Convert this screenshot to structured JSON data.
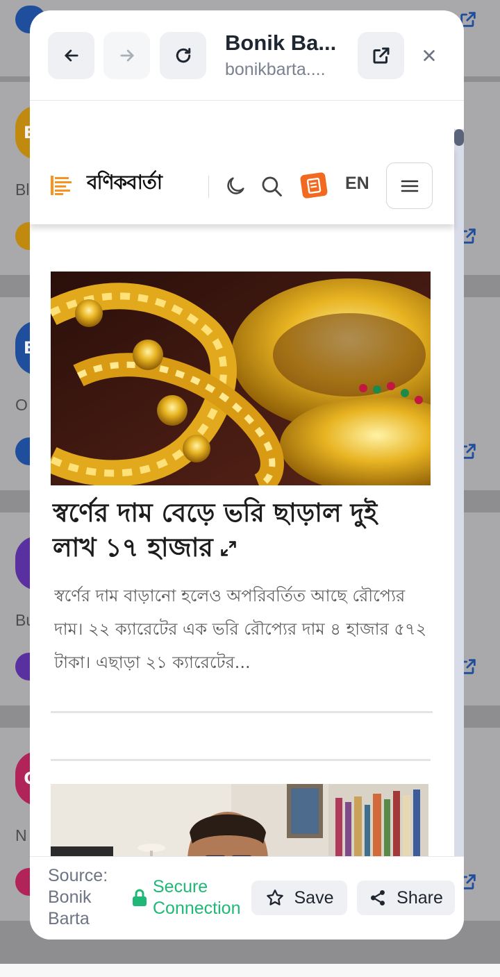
{
  "modal": {
    "title": "Bonik Ba...",
    "url": "bonikbarta....",
    "back_label": "Back",
    "forward_label": "Forward",
    "reload_label": "Reload",
    "open_external_label": "Open in browser",
    "close_label": "Close"
  },
  "site": {
    "logo_text": "বণিকবার্তা",
    "language_toggle": "EN"
  },
  "article": {
    "headline": "স্বর্ণের দাম বেড়ে ভরি ছাড়াল দুই লাখ ১৭ হাজার",
    "summary": "স্বর্ণের দাম বাড়ানো হলেও অপরিবর্তিত আছে রৌপ্যের দাম। ২২ ক্যারেটের এক ভরি রৌপ্যের দাম ৪ হাজার ৫৭২ টাকা। এছাড়া ২১ ক্যারেটের..."
  },
  "footer": {
    "source": "Source: Bonik Barta",
    "secure": "Secure Connection",
    "save_label": "Save",
    "share_label": "Share"
  },
  "background": {
    "avatars": [
      "B",
      "B",
      "C"
    ],
    "snippets": [
      "Bl",
      "O",
      "Bu",
      "N"
    ]
  },
  "colors": {
    "secure_green": "#1fb877",
    "epaper_orange": "#f26a21",
    "logo_orange": "#f7931e"
  }
}
